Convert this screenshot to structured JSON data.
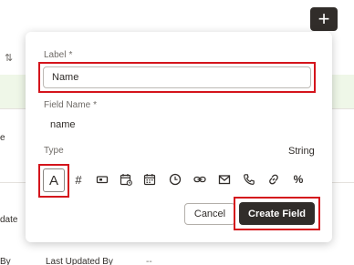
{
  "colors": {
    "accent_dark": "#312d2a",
    "highlight_red": "#d4141c",
    "row_green": "#eff7e8"
  },
  "background": {
    "add_button": "+",
    "add_button_icon": "plus-icon",
    "sort_icon": "sort-arrows-icon",
    "sort_glyph": "⇅",
    "left_fragments": [
      "e",
      "date",
      "By"
    ],
    "bottom_field_label": "Last Updated By",
    "bottom_field_value": "--"
  },
  "panel": {
    "label_caption": "Label",
    "label_required": "*",
    "label_value": "Name",
    "field_name_caption": "Field Name",
    "field_name_required": "*",
    "field_name_value": "name",
    "type_caption": "Type",
    "type_value": "String",
    "type_icons": [
      {
        "name": "text-type-icon",
        "glyph": "A",
        "selected": true
      },
      {
        "name": "number-type-icon",
        "glyph": "#"
      },
      {
        "name": "currency-type-icon",
        "glyph": "card"
      },
      {
        "name": "datetime-type-icon",
        "glyph": "calendar-clock"
      },
      {
        "name": "date-type-icon",
        "glyph": "calendar"
      },
      {
        "name": "time-type-icon",
        "glyph": "clock"
      },
      {
        "name": "link-type-icon",
        "glyph": "link"
      },
      {
        "name": "email-type-icon",
        "glyph": "envelope"
      },
      {
        "name": "phone-type-icon",
        "glyph": "phone"
      },
      {
        "name": "url-type-icon",
        "glyph": "chain"
      },
      {
        "name": "percentage-type-icon",
        "glyph": "%"
      }
    ],
    "cancel_label": "Cancel",
    "create_label": "Create Field"
  }
}
